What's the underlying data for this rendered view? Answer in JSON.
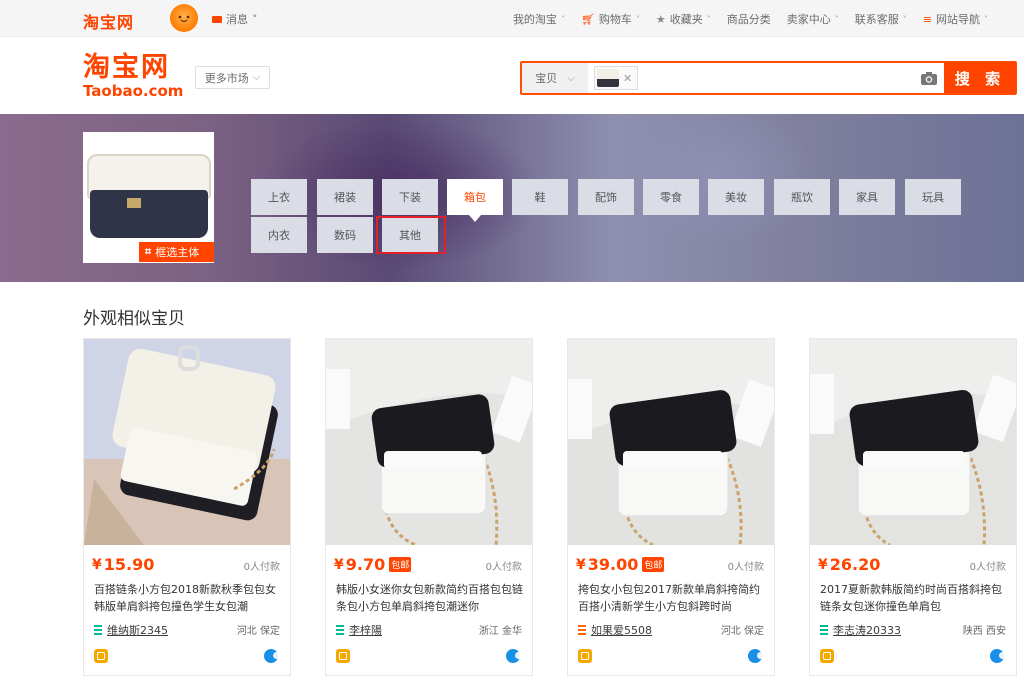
{
  "topbar": {
    "logo": "淘宝网",
    "message": "消息",
    "nav": [
      {
        "label": "我的淘宝",
        "icon": "none"
      },
      {
        "label": "购物车",
        "icon": "cart-icon"
      },
      {
        "label": "收藏夹",
        "icon": "star-icon"
      },
      {
        "label": "商品分类",
        "icon": "none"
      },
      {
        "label": "卖家中心",
        "icon": "none"
      },
      {
        "label": "联系客服",
        "icon": "none"
      },
      {
        "label": "网站导航",
        "icon": "menu-icon"
      }
    ]
  },
  "header": {
    "logo_cn": "淘宝网",
    "logo_en": "Taobao.com",
    "more_markets": "更多市场",
    "search_type": "宝贝",
    "search_button": "搜 索"
  },
  "banner": {
    "crop_label": "框选主体",
    "categories": [
      "上衣",
      "裙装",
      "下装",
      "箱包",
      "鞋",
      "配饰",
      "零食",
      "美妆",
      "瓶饮",
      "家具",
      "玩具",
      "内衣",
      "数码",
      "其他"
    ],
    "active_category": "箱包",
    "highlighted_category": "其他"
  },
  "section_title": "外观相似宝贝",
  "products": [
    {
      "price": "15.90",
      "free_post": "",
      "paid": "0人付款",
      "title": "百搭链条小方包2018新款秋季包包女韩版单肩斜挎包撞色学生女包潮",
      "shop": "维纳斯2345",
      "location": "河北 保定"
    },
    {
      "price": "9.70",
      "free_post": "包邮",
      "paid": "0人付款",
      "title": "韩版小女迷你女包新款简约百搭包包链条包小方包单肩斜挎包潮迷你",
      "shop": "李梓陽",
      "location": "浙江 金华"
    },
    {
      "price": "39.00",
      "free_post": "包邮",
      "paid": "0人付款",
      "title": "挎包女小包包2017新款单肩斜挎简约百搭小清新学生小方包斜跨时尚",
      "shop": "如果爱5508",
      "location": "河北 保定"
    },
    {
      "price": "26.20",
      "free_post": "",
      "paid": "0人付款",
      "title": "2017夏新款韩版简约时尚百搭斜挎包链条女包迷你撞色单肩包",
      "shop": "李志涛20333",
      "location": "陕西 西安"
    }
  ],
  "colors": {
    "accent": "#ff4400",
    "highlight_border": "#e0212b"
  }
}
